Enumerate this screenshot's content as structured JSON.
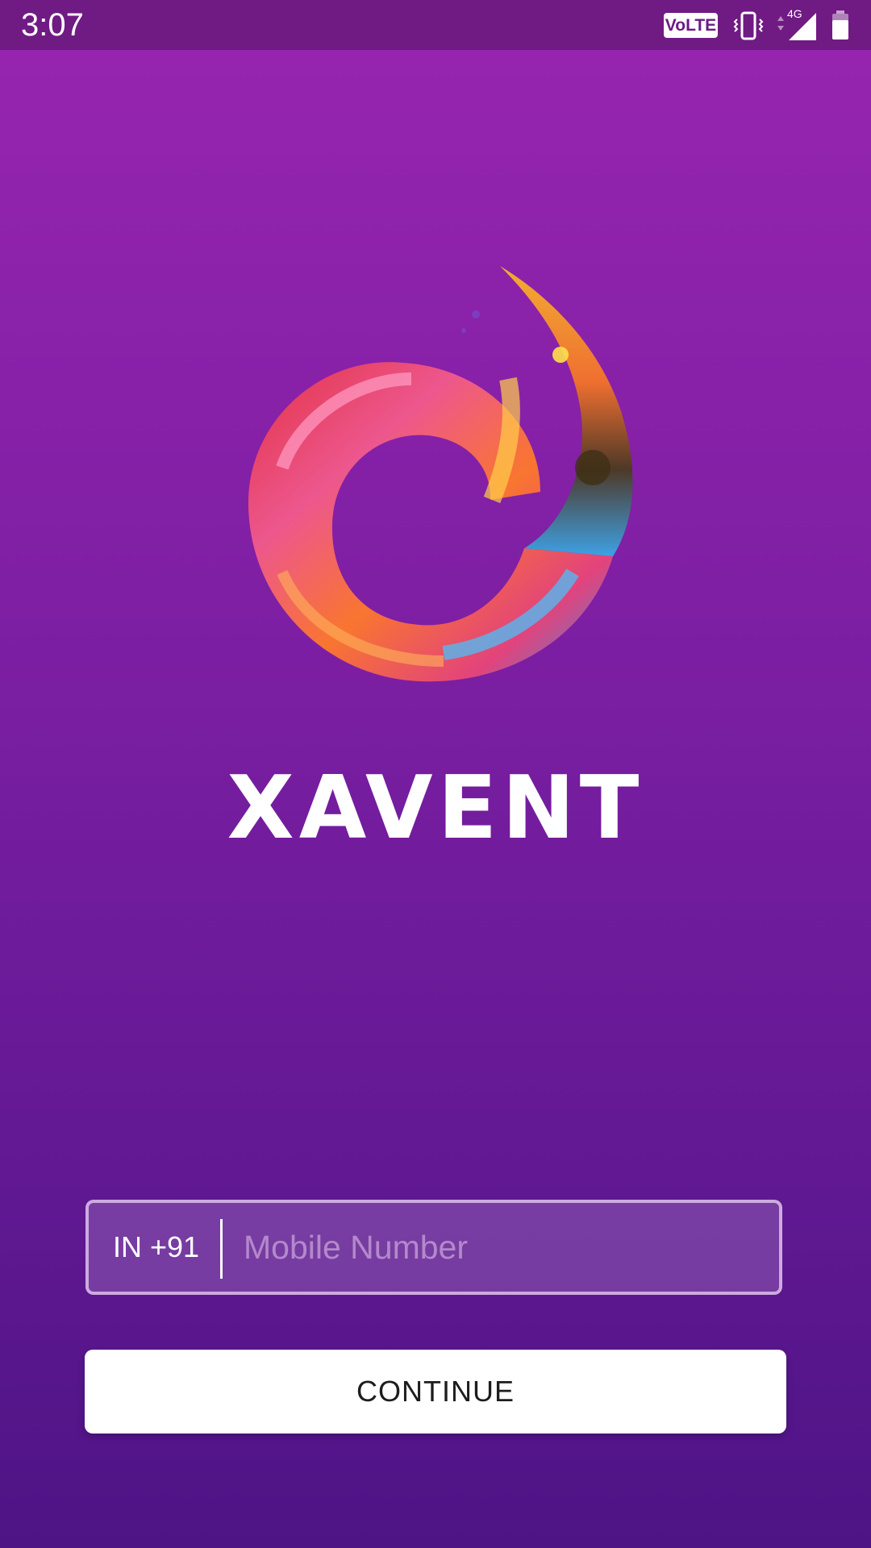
{
  "status_bar": {
    "time": "3:07",
    "volte_label": "VoLTE",
    "network_type": "4G",
    "icons": [
      "vibrate-icon",
      "signal-icon",
      "battery-icon"
    ]
  },
  "brand": {
    "name": "XAVENT",
    "logo": "swirl-logo-icon"
  },
  "login": {
    "country_code": "IN +91",
    "mobile_placeholder": "Mobile Number",
    "mobile_value": "",
    "continue_label": "CONTINUE"
  },
  "colors": {
    "background_top": "#9825b0",
    "background_bottom": "#4e1486",
    "button_background": "#ffffff",
    "button_text": "#1d1d1d"
  }
}
